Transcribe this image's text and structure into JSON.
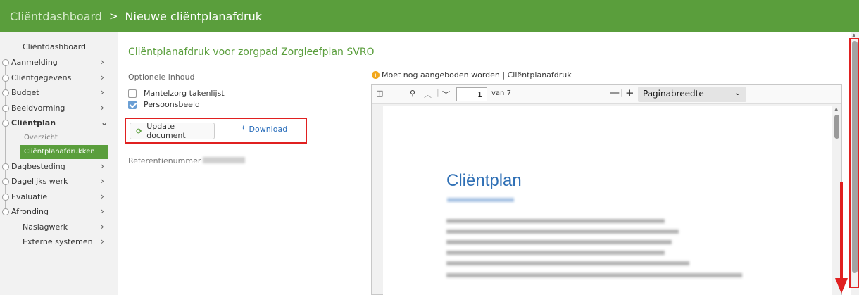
{
  "header": {
    "breadcrumb_parent": "Cliëntdashboard",
    "separator": ">",
    "breadcrumb_current": "Nieuwe cliëntplanafdruk"
  },
  "sidebar": {
    "top_item": "Cliëntdashboard",
    "items": [
      {
        "label": "Aanmelding"
      },
      {
        "label": "Cliëntgegevens"
      },
      {
        "label": "Budget"
      },
      {
        "label": "Beeldvorming"
      },
      {
        "label": "Cliëntplan"
      },
      {
        "label": "Dagbesteding"
      },
      {
        "label": "Dagelijks werk"
      },
      {
        "label": "Evaluatie"
      },
      {
        "label": "Afronding"
      },
      {
        "label": "Naslagwerk"
      },
      {
        "label": "Externe systemen"
      }
    ],
    "sub_items": [
      "Overzicht",
      "Cliëntplanafdrukken"
    ]
  },
  "main": {
    "title": "Cliëntplanafdruk voor zorgpad Zorgleefplan SVRO",
    "optional_heading": "Optionele inhoud",
    "checkboxes": [
      {
        "label": "Mantelzorg takenlijst",
        "checked": false
      },
      {
        "label": "Persoonsbeeld",
        "checked": true
      }
    ],
    "update_button": "Update document",
    "download_link": "Download",
    "reference_label": "Referentienummer"
  },
  "viewer": {
    "notice": "Moet nog aangeboden worden | Cliëntplanafdruk",
    "page_current": "1",
    "page_total": "van 7",
    "zoom_label": "Paginabreedte",
    "doc_title": "Cliëntplan"
  },
  "colors": {
    "brand_green": "#5a9e3c",
    "link_blue": "#2a6ebb",
    "doc_title_blue": "#2e6fb5",
    "annotation_red": "#e02020"
  }
}
